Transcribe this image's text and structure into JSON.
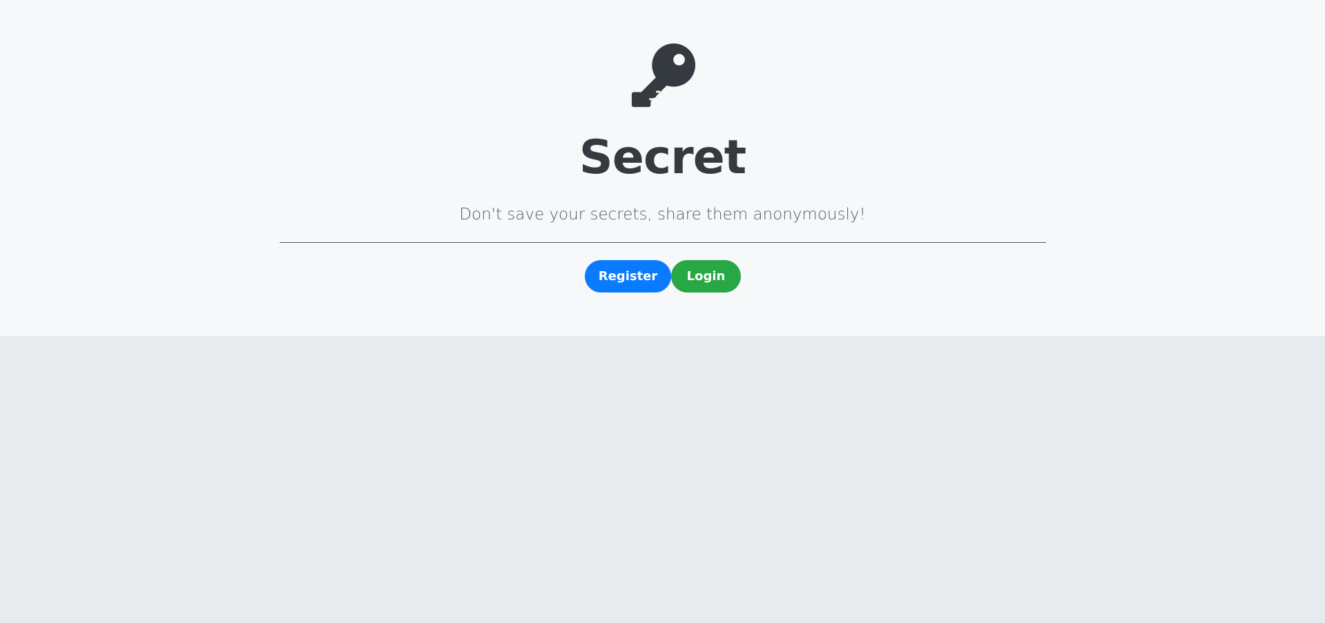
{
  "hero": {
    "icon": "key-icon",
    "title": "Secret",
    "tagline": "Don't save your secrets, share them anonymously!"
  },
  "actions": {
    "register_label": "Register",
    "login_label": "Login"
  },
  "colors": {
    "hero_background": "#f7f8fa",
    "page_background": "#e8ebed",
    "text_dark": "#343a40",
    "register_button": "#0a7bff",
    "login_button": "#28a745"
  }
}
